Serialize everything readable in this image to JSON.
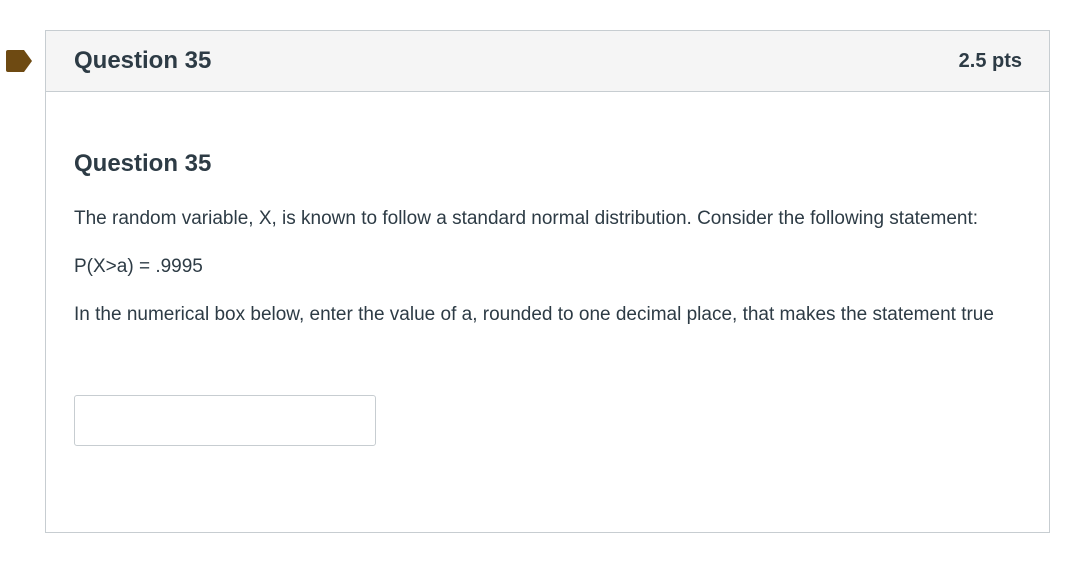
{
  "colors": {
    "flag": "#6e4a12",
    "header_bg": "#f5f5f5",
    "border": "#c7cdd1",
    "text": "#2d3b45"
  },
  "question": {
    "flag_icon": "bookmark-flag-icon",
    "header_title": "Question 35",
    "points": "2.5 pts",
    "body_title": "Question 35",
    "paragraphs": [
      "The random variable, X, is known to follow a standard normal distribution. Consider the following statement:",
      "P(X>a) = .9995",
      "In the numerical box below, enter the value of a, rounded to one decimal place, that makes the statement true"
    ],
    "answer": {
      "value": "",
      "placeholder": ""
    }
  }
}
